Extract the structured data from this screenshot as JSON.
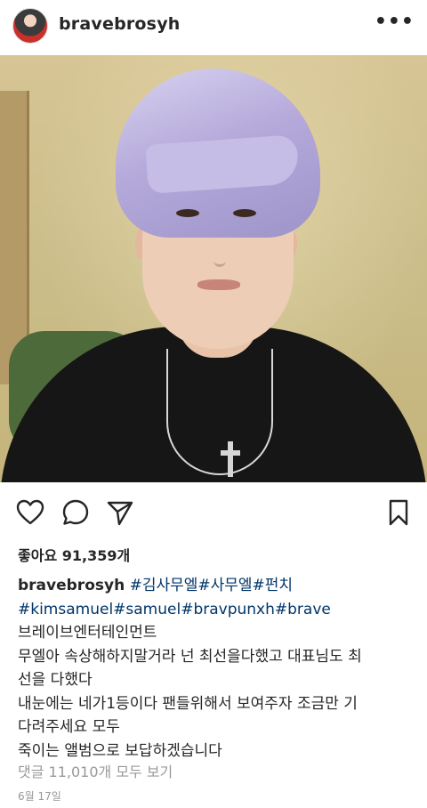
{
  "header": {
    "username": "bravebrosyh",
    "more_icon": "more-dots-icon",
    "more_label": "•••"
  },
  "photo": {
    "alt_description": ""
  },
  "actions": {
    "like_icon": "heart-icon",
    "comment_icon": "comment-bubble-icon",
    "share_icon": "paper-plane-icon",
    "save_icon": "bookmark-icon"
  },
  "likes": {
    "text": "좋아요 91,359개"
  },
  "caption": {
    "username": "bravebrosyh",
    "tags_line1": "#김사무엘#사무엘#펀치",
    "tags_line2": "#kimsamuel#samuel#bravpunxh#brave",
    "line3": "브레이브엔터테인먼트",
    "line4": "무엘아 속상해하지말거라 넌 최선을다했고 대표님도 최",
    "line5": "선을 다했다",
    "line6": "내눈에는 네가1등이다 팬들위해서 보여주자 조금만 기",
    "line7": "다려주세요 모두",
    "line8": "죽이는 앨범으로 보답하겠습니다"
  },
  "comments": {
    "text": "댓글 11,010개 모두 보기"
  },
  "date": {
    "text": "6월 17일"
  },
  "colors": {
    "text": "#262626",
    "hashtag": "#003569",
    "muted": "#999999"
  }
}
